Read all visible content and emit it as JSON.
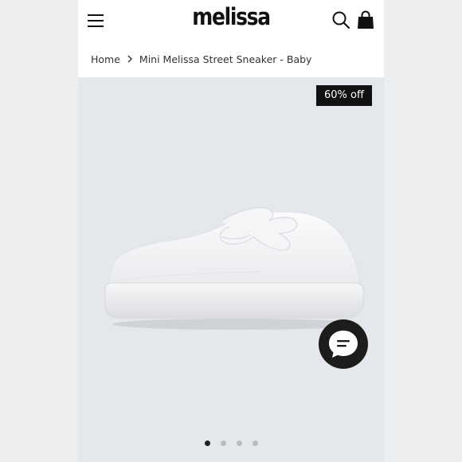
{
  "header": {
    "logo_text": "melissa",
    "menu_icon": "hamburger-menu-icon",
    "search_icon": "search-icon",
    "bag_icon": "shopping-bag-icon"
  },
  "breadcrumb": {
    "home": "Home",
    "current": "Mini Melissa Street Sneaker - Baby"
  },
  "product": {
    "discount_badge": "60% off",
    "image_alt": "white sneaker",
    "gallery": {
      "total_images": 4,
      "active_index": 0
    }
  },
  "chat": {
    "icon": "chat-bubble-icon"
  },
  "colors": {
    "badge_bg": "#111111",
    "page_bg": "#e4e7eb",
    "dot_active": "#222222",
    "dot_inactive": "#b9bcc0"
  }
}
